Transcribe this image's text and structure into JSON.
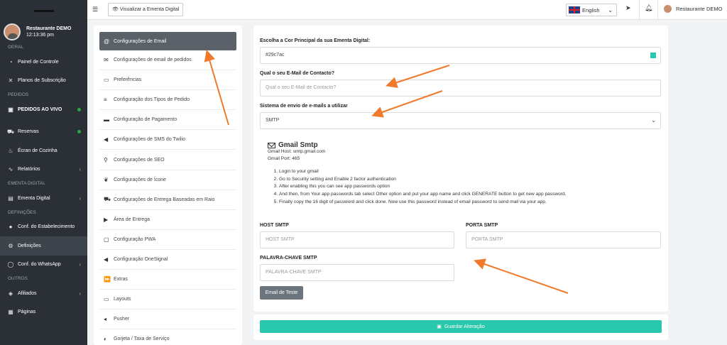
{
  "sidebar": {
    "user_name": "Restaurante DEMO",
    "user_time": "12:13:36 pm",
    "items": [
      {
        "type": "section",
        "label": "GERAL"
      },
      {
        "type": "item",
        "label": "Painel de Controle",
        "icon": "gauge-icon",
        "glyph": "◔"
      },
      {
        "type": "item",
        "label": "Planos de Subscrição",
        "icon": "tools-icon",
        "glyph": "✕"
      },
      {
        "type": "section",
        "label": "PEDIDOS"
      },
      {
        "type": "item",
        "label": "PEDIDOS AO VIVO",
        "icon": "bell-icon",
        "glyph": "▣",
        "dot": true,
        "bold": true
      },
      {
        "type": "section",
        "label": ""
      },
      {
        "type": "item",
        "label": "Reservas",
        "icon": "car-icon",
        "glyph": "⛟",
        "dot": true
      },
      {
        "type": "item",
        "label": "Écran de Cozinha",
        "icon": "fire-icon",
        "glyph": "♨"
      },
      {
        "type": "item",
        "label": "Relatórios",
        "icon": "chart-icon",
        "glyph": "∿",
        "chevron": true
      },
      {
        "type": "section",
        "label": "EMENTA DIGITAL"
      },
      {
        "type": "item",
        "label": "Ementa Digital",
        "icon": "menu-book-icon",
        "glyph": "▤",
        "chevron": true
      },
      {
        "type": "section",
        "label": "DEFINIÇÕES"
      },
      {
        "type": "item",
        "label": "Conf. do Estabelecimento",
        "icon": "user-circle-icon",
        "glyph": "●"
      },
      {
        "type": "item",
        "label": "Definições",
        "icon": "cogs-icon",
        "glyph": "⚙",
        "active": true
      },
      {
        "type": "item",
        "label": "Conf. do WhatsApp",
        "icon": "whatsapp-icon",
        "glyph": "◯",
        "chevron": true
      },
      {
        "type": "section",
        "label": "OUTROS"
      },
      {
        "type": "item",
        "label": "Afiliados",
        "icon": "cube-icon",
        "glyph": "◈",
        "chevron": true
      },
      {
        "type": "item",
        "label": "Páginas",
        "icon": "pages-icon",
        "glyph": "▦"
      }
    ]
  },
  "topbar": {
    "view_button": "Visualizar a Ementa Digital",
    "language": "English",
    "user_name": "Restaurante DEMO"
  },
  "settings_menu": [
    {
      "label": "Configurações de Email",
      "icon": "at-icon",
      "glyph": "@",
      "active": true
    },
    {
      "label": "Configurações de email de pedidos",
      "icon": "envelope-icon",
      "glyph": "✉"
    },
    {
      "label": "Preferências",
      "icon": "chat-icon",
      "glyph": "▭"
    },
    {
      "label": "Configuração dos Tipos de Pedido",
      "icon": "list-icon",
      "glyph": "≡"
    },
    {
      "label": "Configuração de Pagamento",
      "icon": "credit-card-icon",
      "glyph": "▬"
    },
    {
      "label": "Configurações de SMS do Twilio",
      "icon": "megaphone-icon",
      "glyph": "◀"
    },
    {
      "label": "Configurações de SEO",
      "icon": "search-icon",
      "glyph": "⚲"
    },
    {
      "label": "Configurações de Ícone",
      "icon": "leaf-icon",
      "glyph": "❦"
    },
    {
      "label": "Configurações de Entrega Baseadas em Raio",
      "icon": "truck-icon",
      "glyph": "⛟"
    },
    {
      "label": "Área de Entrega",
      "icon": "delivery-icon",
      "glyph": "▶"
    },
    {
      "label": "Configuração PWA",
      "icon": "window-icon",
      "glyph": "▢"
    },
    {
      "label": "Configuração OneSignal",
      "icon": "signal-icon",
      "glyph": "◀"
    },
    {
      "label": "Extras",
      "icon": "forward-icon",
      "glyph": "⏩"
    },
    {
      "label": "Layouts",
      "icon": "layout-icon",
      "glyph": "▭"
    },
    {
      "label": "Pusher",
      "icon": "push-icon",
      "glyph": "◂"
    },
    {
      "label": "Gorjeta / Taxa de Serviço",
      "icon": "coins-icon",
      "glyph": "◐"
    }
  ],
  "form": {
    "color_label": "Escolha a Cor Principal da sua Ementa Digital:",
    "color_value": "#29c7ac",
    "email_label": "Qual o seu E-Mail de Contacto?",
    "email_placeholder": "Qual o seu E-Mail de Contacto?",
    "system_label": "Sistema de envio de e-mails a utilizar",
    "system_value": "SMTP",
    "gmail": {
      "title": "Gmail Smtp",
      "host": "Gmail Host:  smtp.gmail.com",
      "port": "Gmail Port:  465",
      "steps": [
        "Login to your gmail",
        "Go to Security setting and Enable 2 factor authentication",
        "After enabling this you can see app passwords option",
        "And then, from Your app passwords tab select Other option and put your app name and click GENERATE button to get new app password.",
        "Finally copy the 16 digit of password and click done. Now use this password instead of email password to send mail via your app."
      ]
    },
    "host_label": "HOST SMTP",
    "host_placeholder": "HOST SMTP",
    "port_label": "PORTA SMTP",
    "port_placeholder": "PORTA SMTP",
    "password_label": "PALAVRA-CHAVE SMTP",
    "password_placeholder": "PALAVRA-CHAVE SMTP",
    "test_button": "Email de Teste",
    "save_button": "Guardar Alteração"
  },
  "colors": {
    "accent": "#29c7ac",
    "sidebar": "#2a3036",
    "annotation_arrow": "#f07a2a"
  }
}
